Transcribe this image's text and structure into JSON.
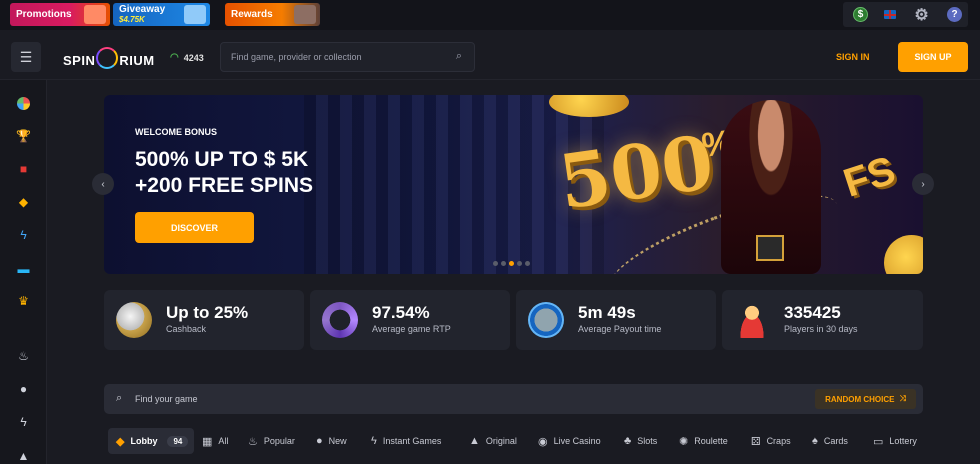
{
  "topbar": {
    "promotions": "Promotions",
    "giveaway": "Giveaway",
    "giveaway_amount": "$4.75K",
    "rewards": "Rewards"
  },
  "header": {
    "logo_left": "SPIN",
    "logo_right": "RIUM",
    "online_count": "4243",
    "search_placeholder": "Find game, provider or collection",
    "signin": "SIGN IN",
    "signup": "SIGN UP"
  },
  "banner": {
    "kicker": "WELCOME BONUS",
    "line1": "500% UP TO $ 5K",
    "line2": "+200 FREE SPINS",
    "cta": "DISCOVER",
    "art_number": "500",
    "art_percent": "%",
    "art_fs": "FS",
    "slides": 5,
    "active_slide": 3
  },
  "stats": [
    {
      "value": "Up to 25%",
      "label": "Cashback"
    },
    {
      "value": "97.54%",
      "label": "Average game RTP"
    },
    {
      "value": "5m 49s",
      "label": "Average Payout time"
    },
    {
      "value": "335425",
      "label": "Players in 30 days"
    }
  ],
  "finder": {
    "placeholder": "Find your game",
    "random": "RANDOM CHOICE"
  },
  "categories": {
    "lobby": "Lobby",
    "lobby_count": "94",
    "all": "All",
    "popular": "Popular",
    "new": "New",
    "instant": "Instant Games",
    "original": "Original",
    "live": "Live Casino",
    "slots": "Slots",
    "roulette": "Roulette",
    "craps": "Craps",
    "cards": "Cards",
    "lottery": "Lottery"
  },
  "colors": {
    "accent": "#ffa000",
    "background": "#1a1b22",
    "card": "#22242d"
  }
}
